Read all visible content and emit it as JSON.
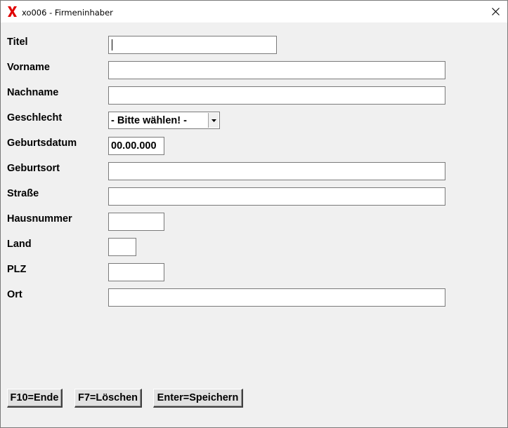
{
  "window": {
    "title": "xo006 - Firmeninhaber",
    "app_icon": "red-x-icon",
    "close_icon": "close-icon"
  },
  "form": {
    "titel": {
      "label": "Titel",
      "value": ""
    },
    "vorname": {
      "label": "Vorname",
      "value": ""
    },
    "nachname": {
      "label": "Nachname",
      "value": ""
    },
    "geschlecht": {
      "label": "Geschlecht",
      "selected": "- Bitte wählen! -"
    },
    "geburtsdatum": {
      "label": "Geburtsdatum",
      "value": "00.00.000"
    },
    "geburtsort": {
      "label": "Geburtsort",
      "value": ""
    },
    "strasse": {
      "label": "Straße",
      "value": ""
    },
    "hausnummer": {
      "label": "Hausnummer",
      "value": ""
    },
    "land": {
      "label": "Land",
      "value": ""
    },
    "plz": {
      "label": "PLZ",
      "value": ""
    },
    "ort": {
      "label": "Ort",
      "value": ""
    }
  },
  "buttons": {
    "ende": "F10=Ende",
    "loeschen": "F7=Löschen",
    "speichern": "Enter=Speichern"
  },
  "colors": {
    "app_icon": "#e00000",
    "window_bg": "#f0f0f0",
    "titlebar_bg": "#ffffff",
    "field_border": "#7a7a7a"
  }
}
